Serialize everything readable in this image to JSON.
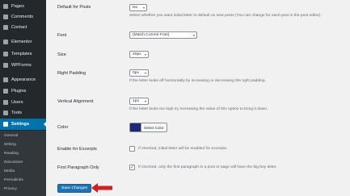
{
  "sidebar": {
    "items": [
      {
        "label": "Pages",
        "icon": "pages-icon"
      },
      {
        "label": "Comments",
        "icon": "comments-icon"
      },
      {
        "label": "Contact",
        "icon": "contact-icon"
      },
      {
        "label": "Elementor",
        "icon": "elementor-icon"
      },
      {
        "label": "Templates",
        "icon": "templates-icon"
      },
      {
        "label": "WPForms",
        "icon": "wpforms-icon"
      },
      {
        "label": "Appearance",
        "icon": "appearance-icon"
      },
      {
        "label": "Plugins",
        "icon": "plugins-icon"
      },
      {
        "label": "Users",
        "icon": "users-icon"
      },
      {
        "label": "Tools",
        "icon": "tools-icon"
      },
      {
        "label": "Settings",
        "icon": "settings-icon"
      }
    ],
    "submenu": [
      "General",
      "Writing",
      "Reading",
      "Discussion",
      "Media",
      "Permalinks",
      "Privacy"
    ],
    "accent_color": "#0073aa"
  },
  "settings": {
    "default_for_posts": {
      "label": "Default for Posts",
      "value": "No",
      "description": "Select whether you want initial letter to default on new posts (You can change for each post in the post editor)."
    },
    "font": {
      "label": "Font",
      "value": "(Match Current Font)"
    },
    "size": {
      "label": "Size",
      "value": "40px"
    },
    "right_padding": {
      "label": "Right Padding",
      "value": "0px",
      "description": "If the letter looks off horizontally by increasing or decreasing the right padding."
    },
    "vertical_alignment": {
      "label": "Vertical Alignment",
      "value": "1px",
      "description": "If the letter looks too high try increasing the value of this option to bring it down."
    },
    "color": {
      "label": "Color",
      "button_label": "Select Color",
      "swatch": "#1e2a78"
    },
    "enable_for_excerpts": {
      "label": "Enable for Excerpts",
      "checked": false,
      "description": "If checked, initial letter will be enabled for excerpts."
    },
    "first_paragraph_only": {
      "label": "First Paragraph Only",
      "checked": true,
      "check_glyph": "✓",
      "description": "If checked, only the first paragraph in a post or page will have the big boy letter."
    }
  },
  "save_button": {
    "label": "Save Changes",
    "color": "#2271b1"
  },
  "annotation_arrow_color": "#d21f1f"
}
